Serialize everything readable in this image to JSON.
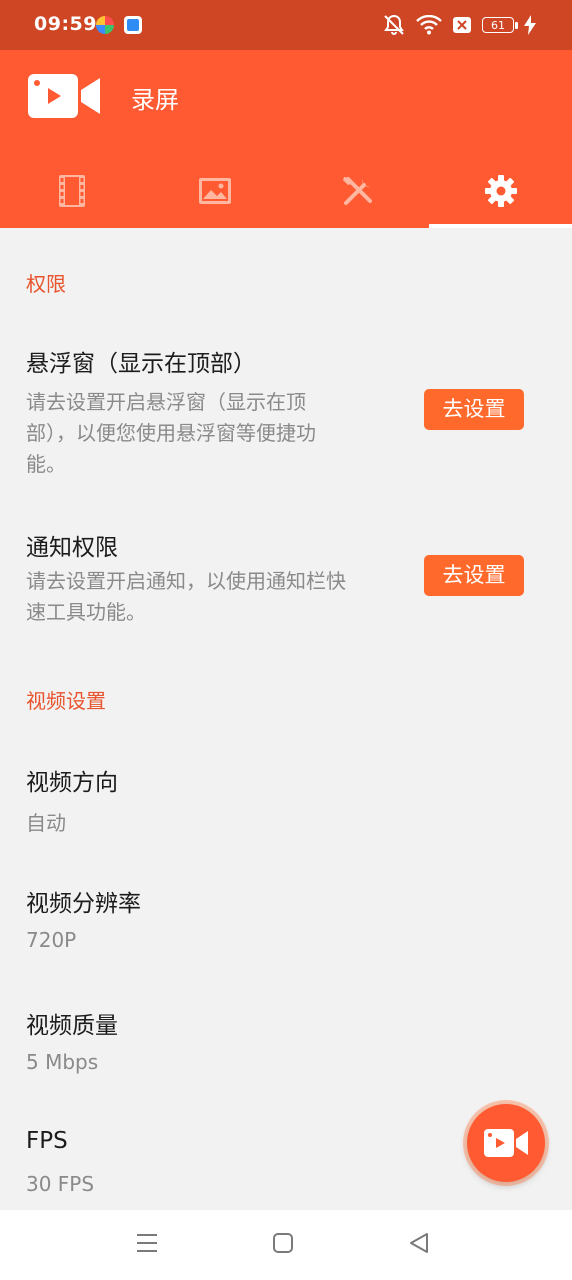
{
  "status_bar": {
    "time": "09:59",
    "battery": "61"
  },
  "app_bar": {
    "title": "录屏",
    "tabs": [
      {
        "icon": "film-icon",
        "active": false
      },
      {
        "icon": "image-icon",
        "active": false
      },
      {
        "icon": "tools-icon",
        "active": false
      },
      {
        "icon": "gear-icon",
        "active": true
      }
    ]
  },
  "sections": {
    "permissions": {
      "header": "权限",
      "floating_window": {
        "title": "悬浮窗（显示在顶部）",
        "desc_line1": "请去设置开启悬浮窗（显示在顶",
        "desc_line2": "部），以便您使用悬浮窗等便捷功",
        "desc_line3": "能。",
        "button": "去设置"
      },
      "notification": {
        "title": "通知权限",
        "desc_line1": "请去设置开启通知，以使用通知栏快",
        "desc_line2": "速工具功能。",
        "button": "去设置"
      }
    },
    "video": {
      "header": "视频设置",
      "orientation": {
        "title": "视频方向",
        "value": "自动"
      },
      "resolution": {
        "title": "视频分辨率",
        "value": "720P"
      },
      "quality": {
        "title": "视频质量",
        "value": "5 Mbps"
      },
      "fps": {
        "title": "FPS",
        "value": "30 FPS"
      }
    }
  },
  "colors": {
    "accent": "#ff5a31",
    "status_bar": "#cf4625",
    "section_header": "#e8542d",
    "button": "#ff6a2c"
  }
}
